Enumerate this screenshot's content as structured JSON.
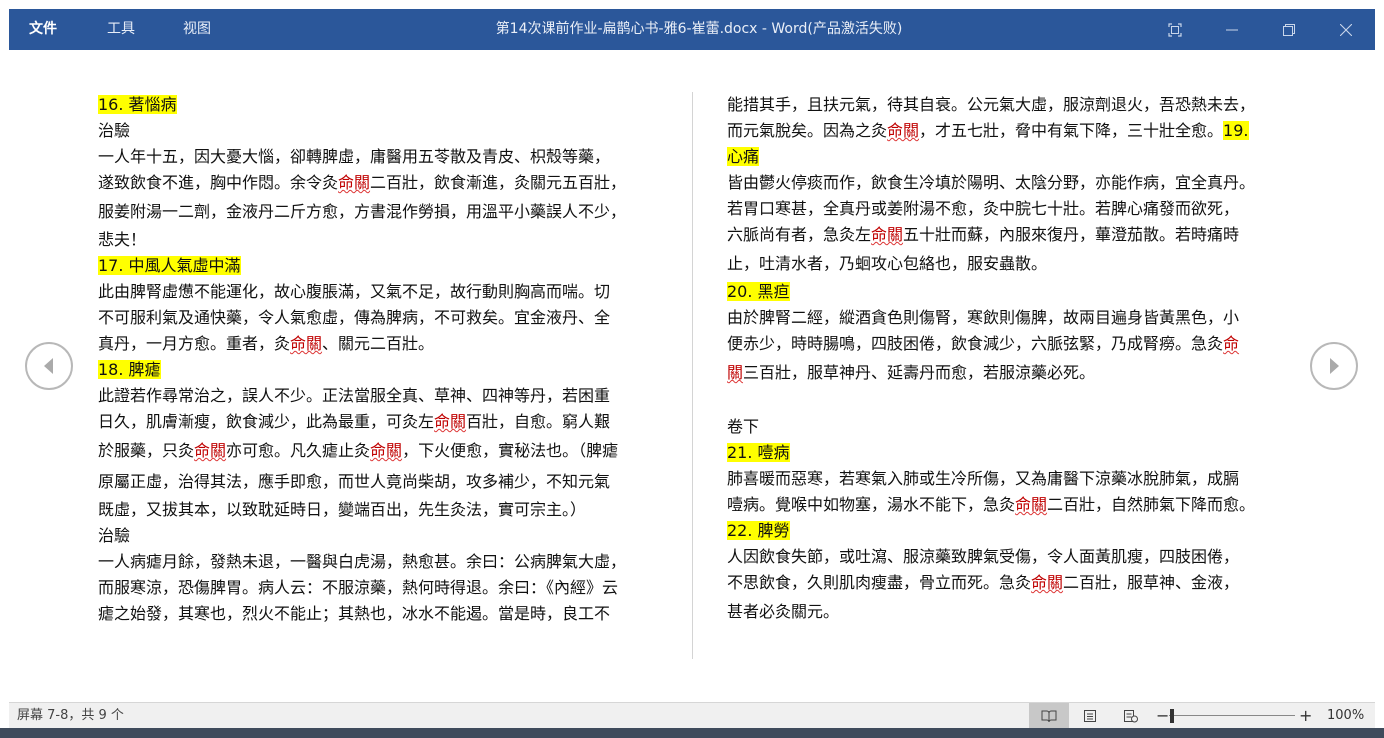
{
  "titlebar": {
    "menu": [
      "文件",
      "工具",
      "视图"
    ],
    "doc_title": "第14次课前作业-扁鹊心书-雅6-崔蕾.docx - Word(产品激活失败)",
    "controls": [
      "focus-mode-icon",
      "minimize-icon",
      "restore-icon",
      "close-icon"
    ]
  },
  "left_column": [
    {
      "type": "heading",
      "text": "16.  著惱病"
    },
    {
      "type": "text",
      "runs": [
        {
          "t": "治驗"
        }
      ]
    },
    {
      "type": "text",
      "runs": [
        {
          "t": "一人年十五，因大憂大惱，卻轉脾虛，庸醫用五苓散及青皮、枳殼等藥，"
        }
      ]
    },
    {
      "type": "text",
      "runs": [
        {
          "t": "遂致飲食不進，胸中作悶。余令灸"
        },
        {
          "t": "命關",
          "e": true
        },
        {
          "t": "二百壯，飲食漸進，灸關元五百壯，"
        }
      ]
    },
    {
      "type": "text",
      "loose": true,
      "runs": [
        {
          "t": "服姜附湯一二劑，金液丹二斤方愈，方書混作勞損，用溫平小藥誤人不少，"
        }
      ]
    },
    {
      "type": "text",
      "runs": [
        {
          "t": "悲夫！"
        }
      ]
    },
    {
      "type": "heading",
      "text": "17.  中風人氣虛中滿"
    },
    {
      "type": "text",
      "runs": [
        {
          "t": "此由脾腎虛憊不能運化，故心腹脹滿，又氣不足，故行動則胸高而喘。切"
        }
      ]
    },
    {
      "type": "text",
      "runs": [
        {
          "t": "不可服利氣及通快藥，令人氣愈虛，傳為脾病，不可救矣。宜金液丹、全"
        }
      ]
    },
    {
      "type": "text",
      "runs": [
        {
          "t": "真丹，一月方愈。重者，灸"
        },
        {
          "t": "命關",
          "e": true
        },
        {
          "t": "、關元二百壯。"
        }
      ]
    },
    {
      "type": "heading",
      "text": "18.  脾瘧"
    },
    {
      "type": "text",
      "runs": [
        {
          "t": "此證若作尋常治之，誤人不少。正法當服全真、草神、四神等丹，若困重"
        }
      ]
    },
    {
      "type": "text",
      "runs": [
        {
          "t": "日久，肌膚漸瘦，飲食減少，此為最重，可灸左"
        },
        {
          "t": "命關",
          "e": true
        },
        {
          "t": "百壯，自愈。窮人艱"
        }
      ]
    },
    {
      "type": "text",
      "loose": true,
      "runs": [
        {
          "t": "於服藥，只灸"
        },
        {
          "t": "命關",
          "e": true
        },
        {
          "t": "亦可愈。凡久瘧止灸"
        },
        {
          "t": "命關",
          "e": true
        },
        {
          "t": "，下火便愈，實秘法也。（脾瘧"
        }
      ]
    },
    {
      "type": "text",
      "loose": true,
      "runs": [
        {
          "t": "原屬正虛，治得其法，應手即愈，而世人竟尚柴胡，攻多補少，不知元氣"
        }
      ]
    },
    {
      "type": "text",
      "runs": [
        {
          "t": "既虛，又拔其本，以致耽延時日，變端百出，先生灸法，實可宗主。）"
        }
      ]
    },
    {
      "type": "text",
      "runs": [
        {
          "t": "治驗"
        }
      ]
    },
    {
      "type": "text",
      "runs": [
        {
          "t": "一人病瘧月餘，發熱未退，一醫與白虎湯，熱愈甚。余曰：公病脾氣大虛，"
        }
      ]
    },
    {
      "type": "text",
      "runs": [
        {
          "t": "而服寒涼，恐傷脾胃。病人云：不服涼藥，熱何時得退。余曰：《內經》云"
        }
      ]
    },
    {
      "type": "text",
      "runs": [
        {
          "t": "瘧之始發，其寒也，烈火不能止；其熱也，冰水不能遏。當是時，良工不"
        }
      ]
    }
  ],
  "right_column": [
    {
      "type": "text",
      "runs": [
        {
          "t": "能措其手，且扶元氣，待其自衰。公元氣大虛，服涼劑退火，吾恐熱未去，"
        }
      ]
    },
    {
      "type": "text",
      "runs": [
        {
          "t": "而元氣脫矣。因為之灸"
        },
        {
          "t": "命關",
          "e": true
        },
        {
          "t": "，才五七壯，脅中有氣下降，三十壯全愈。"
        },
        {
          "t": "19.",
          "h": true
        }
      ]
    },
    {
      "type": "heading",
      "text": "心痛"
    },
    {
      "type": "text",
      "runs": [
        {
          "t": "皆由鬱火停痰而作，飲食生冷填於陽明、太陰分野，亦能作病，宜全真丹。"
        }
      ]
    },
    {
      "type": "text",
      "runs": [
        {
          "t": "若胃口寒甚，全真丹或姜附湯不愈，灸中脘七十壯。若脾心痛發而欲死，"
        }
      ]
    },
    {
      "type": "text",
      "runs": [
        {
          "t": "六脈尚有者，急灸左"
        },
        {
          "t": "命關",
          "e": true
        },
        {
          "t": "五十壯而蘇，內服來復丹，蓽澄茄散。若時痛時"
        }
      ]
    },
    {
      "type": "text",
      "loose": true,
      "runs": [
        {
          "t": "止，吐清水者，乃蛔攻心包絡也，服安蟲散。"
        }
      ]
    },
    {
      "type": "heading",
      "text": "20.  黑疸"
    },
    {
      "type": "text",
      "runs": [
        {
          "t": "由於脾腎二經，縱酒貪色則傷腎，寒飲則傷脾，故兩目遍身皆黃黑色，小"
        }
      ]
    },
    {
      "type": "text",
      "runs": [
        {
          "t": "便赤少，時時腸鳴，四肢困倦，飲食減少，六脈弦緊，乃成腎癆。急灸"
        },
        {
          "t": "命",
          "e": true
        }
      ]
    },
    {
      "type": "text",
      "loose": true,
      "runs": [
        {
          "t": "關",
          "e": true
        },
        {
          "t": "三百壯，服草神丹、延壽丹而愈，若服涼藥必死。"
        }
      ]
    },
    {
      "type": "blank"
    },
    {
      "type": "text",
      "runs": [
        {
          "t": "卷下"
        }
      ]
    },
    {
      "type": "heading",
      "text": "21.  噎病"
    },
    {
      "type": "text",
      "runs": [
        {
          "t": "肺喜暖而惡寒，若寒氣入肺或生冷所傷，又為庸醫下涼藥冰脫肺氣，成膈"
        }
      ]
    },
    {
      "type": "text",
      "runs": [
        {
          "t": "噎病。覺喉中如物塞，湯水不能下，急灸"
        },
        {
          "t": "命關",
          "e": true
        },
        {
          "t": "二百壯，自然肺氣下降而愈。"
        }
      ]
    },
    {
      "type": "heading",
      "text": "22.  脾勞"
    },
    {
      "type": "text",
      "runs": [
        {
          "t": "人因飲食失節，或吐瀉、服涼藥致脾氣受傷，令人面黃肌瘦，四肢困倦，"
        }
      ]
    },
    {
      "type": "text",
      "runs": [
        {
          "t": "不思飲食，久則肌肉瘦盡，骨立而死。急灸"
        },
        {
          "t": "命關",
          "e": true
        },
        {
          "t": "二百壯，服草神、金液，"
        }
      ]
    },
    {
      "type": "text",
      "loose": true,
      "runs": [
        {
          "t": "甚者必灸關元。"
        }
      ]
    }
  ],
  "status": {
    "page_count": "屏幕 7-8，共 9 个",
    "zoom": "100%",
    "zoom_minus": "−",
    "zoom_plus": "+",
    "zoom_level": 0.0,
    "views": [
      "read-mode-icon",
      "print-layout-icon",
      "web-layout-icon"
    ],
    "active_view": 0
  },
  "nav": {
    "prev": "previous-screen-arrow-icon",
    "next": "next-screen-arrow-icon"
  },
  "colors": {
    "titlebar": "#2b579a",
    "highlight": "#ffff00",
    "spell_error": "#c00000"
  }
}
